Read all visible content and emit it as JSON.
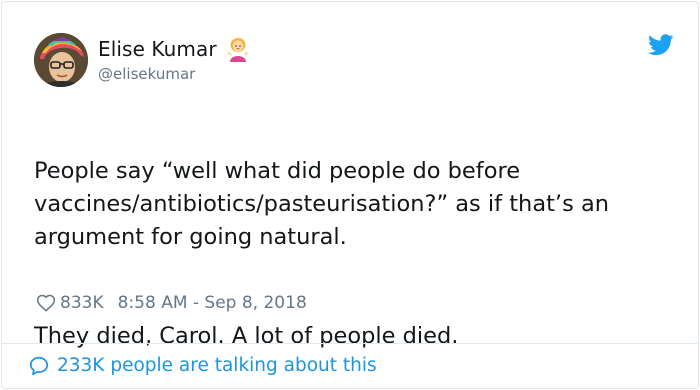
{
  "user": {
    "display_name": "Elise Kumar",
    "handle": "@elisekumar",
    "name_emoji": "woman-shrugging-emoji"
  },
  "tweet": {
    "paragraph_1": "People say “well what did people do before vaccines/antibiotics/pasteurisation?” as if that’s an argument for going natural.",
    "paragraph_2": "They died, Carol. A lot of people died."
  },
  "meta": {
    "likes": "833K",
    "timestamp": "8:58 AM - Sep 8, 2018"
  },
  "footer": {
    "label": "233K people are talking about this"
  },
  "icons": {
    "brand": "twitter-bird-icon",
    "like": "heart-icon",
    "reply": "speech-bubble-icon"
  },
  "colors": {
    "twitter_blue": "#1da1f2",
    "link_blue": "#1b95e0",
    "muted_text": "#657786",
    "border": "#e1e8ed"
  }
}
